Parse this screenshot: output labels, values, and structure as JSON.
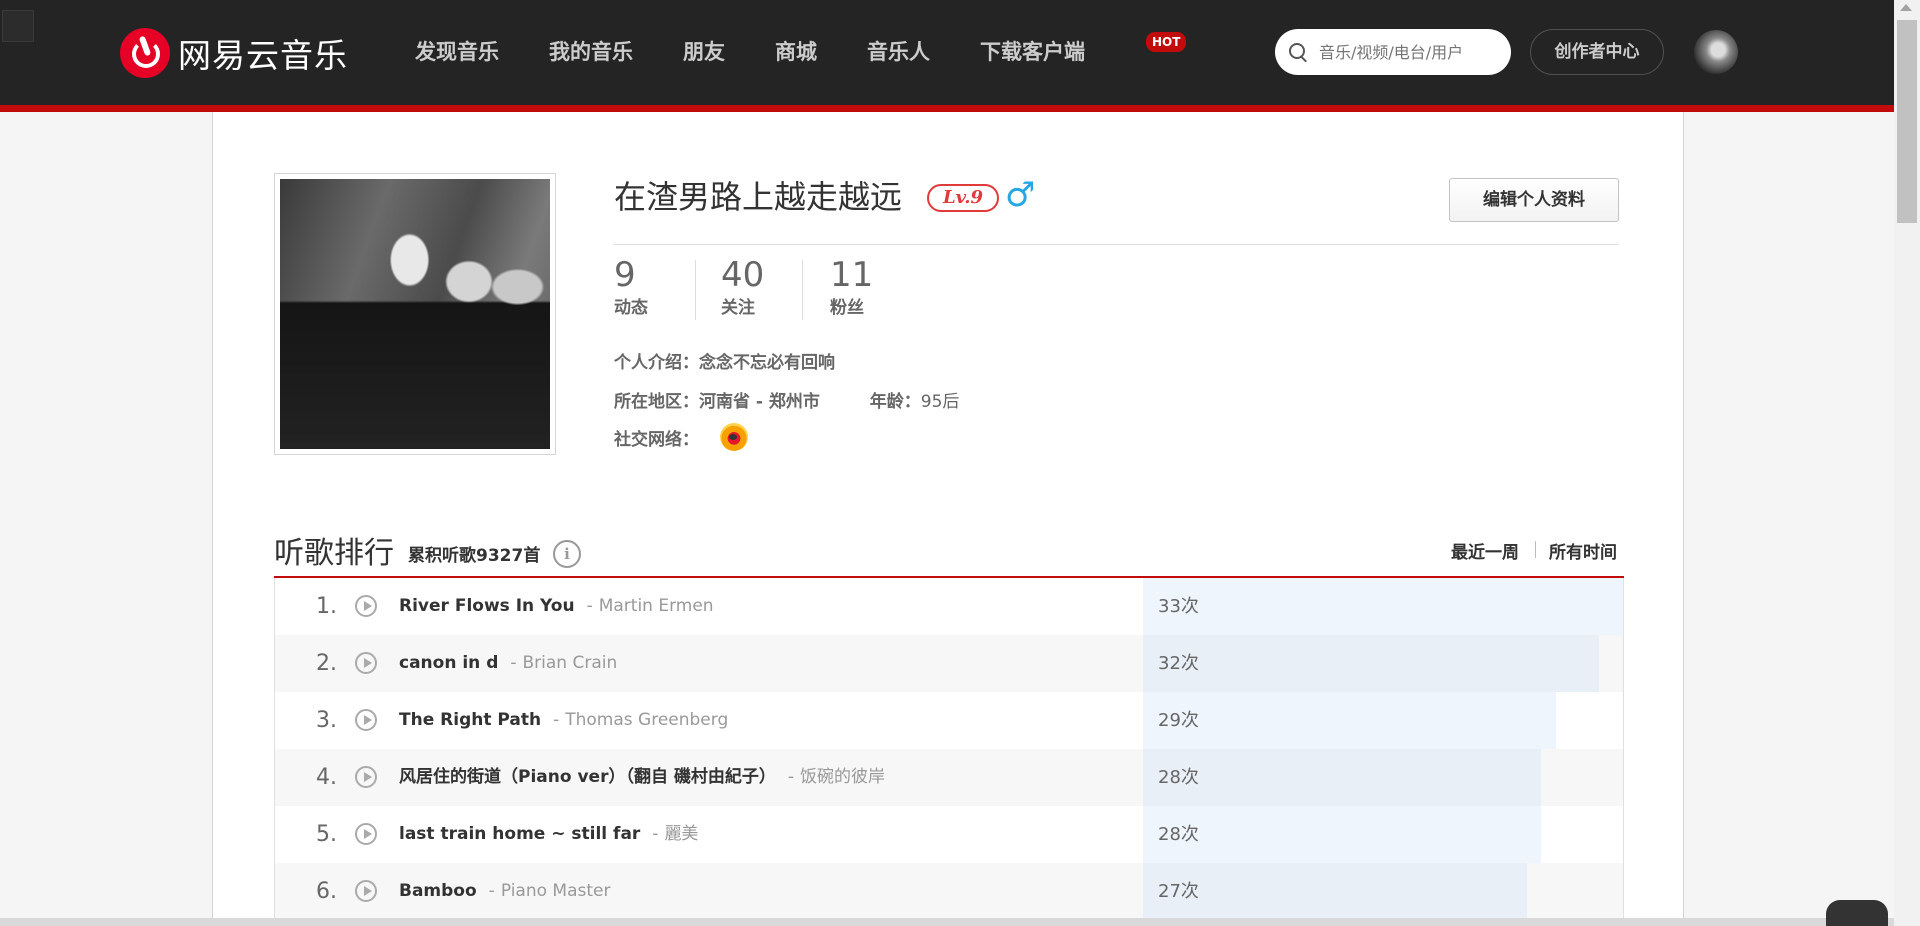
{
  "nav": {
    "logo_text": "网易云音乐",
    "items": [
      {
        "label": "发现音乐"
      },
      {
        "label": "我的音乐"
      },
      {
        "label": "朋友"
      },
      {
        "label": "商城"
      },
      {
        "label": "音乐人"
      },
      {
        "label": "下载客户端"
      }
    ],
    "hot_badge": "HOT",
    "search_placeholder": "音乐/视频/电台/用户",
    "creator_center": "创作者中心",
    "accent_color": "#c20c0c"
  },
  "profile": {
    "username": "在渣男路上越走越远",
    "level": "Lv.9",
    "gender_icon": "♂",
    "edit_button": "编辑个人资料",
    "stats": [
      {
        "value": "9",
        "label": "动态"
      },
      {
        "value": "40",
        "label": "关注"
      },
      {
        "value": "11",
        "label": "粉丝"
      }
    ],
    "intro_label": "个人介绍：",
    "intro_value": "念念不忘必有回响",
    "region_label": "所在地区：",
    "region_value": "河南省 - 郑州市",
    "age_label": "年龄：",
    "age_value": "95后",
    "social_label": "社交网络：",
    "social_icon": "weibo-icon"
  },
  "ranking": {
    "title": "听歌排行",
    "total": "累积听歌9327首",
    "info_glyph": "i",
    "tab_week": "最近一周",
    "tab_all": "所有时间",
    "rows": [
      {
        "rank": "1.",
        "title": "River Flows In You",
        "sep": "-",
        "artist": "Martin Ermen",
        "count": "33次",
        "ratio": 1.0
      },
      {
        "rank": "2.",
        "title": "canon in d",
        "sep": "-",
        "artist": "Brian Crain",
        "count": "32次",
        "ratio": 0.95
      },
      {
        "rank": "3.",
        "title": "The Right Path",
        "sep": "-",
        "artist": "Thomas Greenberg",
        "count": "29次",
        "ratio": 0.86
      },
      {
        "rank": "4.",
        "title": "风居住的街道（Piano ver）（翻自 磯村由紀子）",
        "sep": "-",
        "artist": "饭碗的彼岸",
        "count": "28次",
        "ratio": 0.83
      },
      {
        "rank": "5.",
        "title": "last train home ~ still far",
        "sep": "-",
        "artist": "麗美",
        "count": "28次",
        "ratio": 0.83
      },
      {
        "rank": "6.",
        "title": "Bamboo",
        "sep": "-",
        "artist": "Piano Master",
        "count": "27次",
        "ratio": 0.8
      }
    ]
  }
}
